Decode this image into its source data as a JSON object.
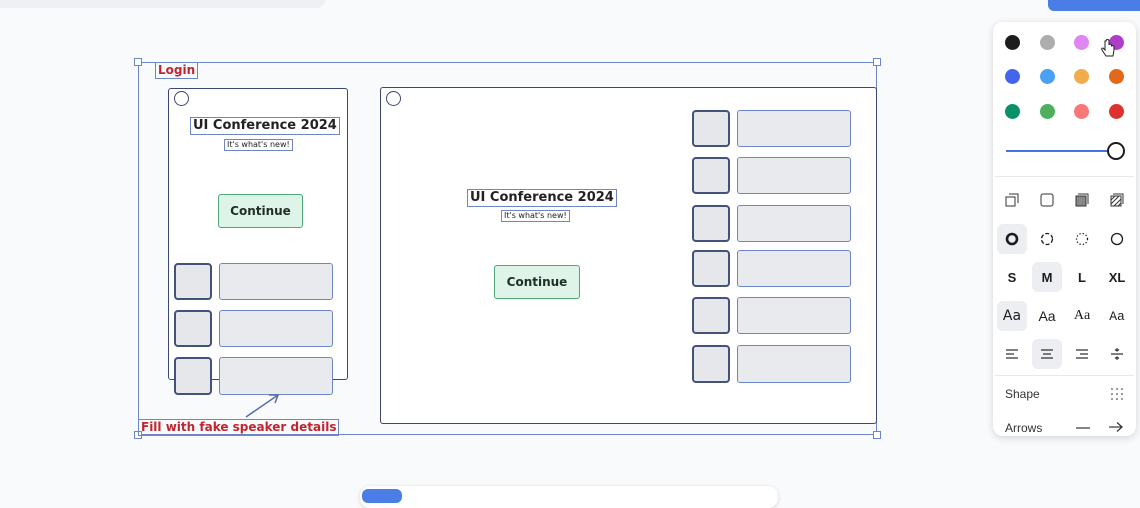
{
  "canvas": {
    "login_label": "Login",
    "note_label": "Fill with fake speaker details",
    "mobile": {
      "title": "UI Conference 2024",
      "subtitle": "It's what's new!",
      "button": "Continue"
    },
    "desktop": {
      "title": "UI Conference 2024",
      "subtitle": "It's what's new!",
      "button": "Continue"
    }
  },
  "style_panel": {
    "colors": [
      {
        "name": "black",
        "hex": "#1d1d1d"
      },
      {
        "name": "grey",
        "hex": "#adadad"
      },
      {
        "name": "light-violet",
        "hex": "#e085f4"
      },
      {
        "name": "violet",
        "hex": "#ae3ec9"
      },
      {
        "name": "blue",
        "hex": "#4465e9"
      },
      {
        "name": "light-blue",
        "hex": "#4ba1f1"
      },
      {
        "name": "yellow",
        "hex": "#f1ac4b"
      },
      {
        "name": "orange",
        "hex": "#e16919"
      },
      {
        "name": "green",
        "hex": "#099268"
      },
      {
        "name": "light-green",
        "hex": "#4cb05e"
      },
      {
        "name": "light-red",
        "hex": "#f87777"
      },
      {
        "name": "red",
        "hex": "#e03131"
      }
    ],
    "opacity": 1.0,
    "sizes": [
      "S",
      "M",
      "L",
      "XL"
    ],
    "selected_size": "M",
    "font_samples": [
      "Aa",
      "Aa",
      "Aa",
      "Aa"
    ],
    "shape_label": "Shape",
    "arrows_label": "Arrows"
  }
}
